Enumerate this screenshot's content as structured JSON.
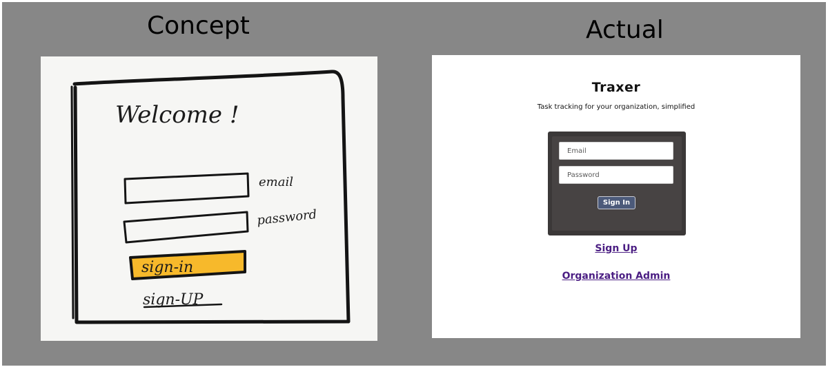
{
  "concept": {
    "heading": "Concept",
    "welcome": "Welcome !",
    "email_label": "email",
    "password_label": "password",
    "signin_label": "sign-in",
    "signup_label": "sign-UP",
    "button_color": "#f7b92b"
  },
  "actual": {
    "heading": "Actual",
    "app_title": "Traxer",
    "tagline": "Task tracking for your organization, simplified",
    "email_placeholder": "Email",
    "password_placeholder": "Password",
    "signin_label": "Sign In",
    "signup_link": "Sign Up",
    "org_admin_link": "Organization Admin",
    "link_color": "#4b1e83"
  }
}
